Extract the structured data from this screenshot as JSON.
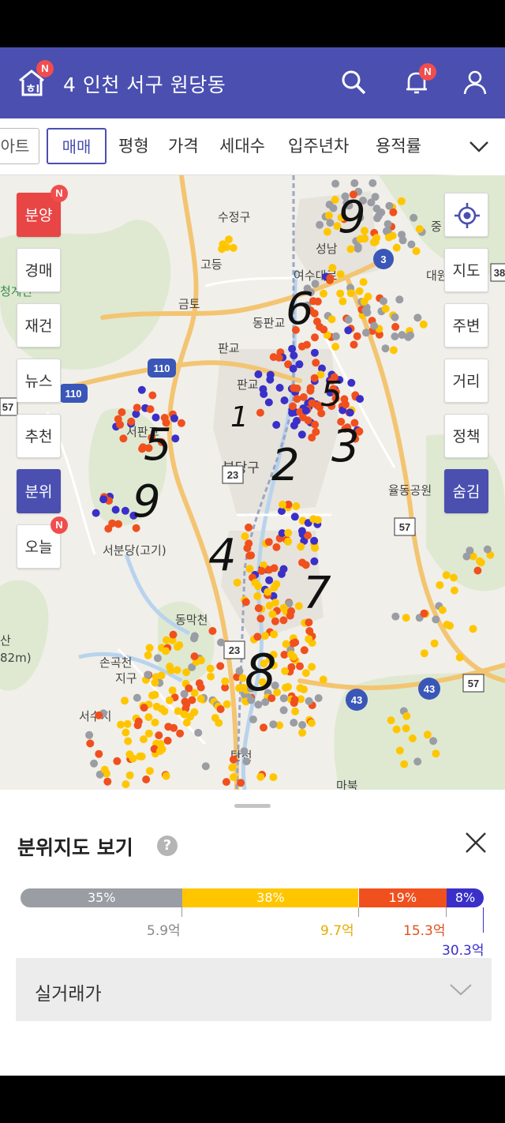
{
  "header": {
    "badge": "N",
    "region_title": "4 인천 서구 원당동",
    "notification_badge": "N"
  },
  "filter_bar": {
    "partial_chip": "아트",
    "active_chip": "매매",
    "tabs": [
      "평형",
      "가격",
      "세대수",
      "입주년차",
      "용적률"
    ]
  },
  "map": {
    "place_labels": [
      "수정구",
      "성남",
      "여수대로",
      "고등",
      "금토",
      "동판교",
      "판교",
      "판교",
      "서판교",
      "분당구",
      "율동공원",
      "서분당(고기)",
      "동막천",
      "손곡천",
      "지구",
      "서수지",
      "탄천",
      "마북",
      "중",
      "대원",
      "청계산",
      "산",
      "82m)"
    ],
    "road_numbers": [
      "110",
      "110",
      "57",
      "23",
      "23",
      "57",
      "43",
      "43",
      "3",
      "38",
      "57"
    ],
    "handwritten_numbers": [
      "9",
      "6",
      "5",
      "1",
      "5",
      "3",
      "2",
      "9",
      "4",
      "7",
      "8"
    ],
    "left_buttons": [
      {
        "label": "분양",
        "badge": "N"
      },
      {
        "label": "경매"
      },
      {
        "label": "재건"
      },
      {
        "label": "뉴스"
      },
      {
        "label": "추천"
      },
      {
        "label": "분위"
      },
      {
        "label": "오늘",
        "badge": "N"
      }
    ],
    "right_buttons": [
      "지도",
      "주변",
      "거리",
      "정책",
      "숨김"
    ]
  },
  "sheet": {
    "title": "분위지도 보기",
    "help": "?",
    "bar": [
      {
        "percent": "35%",
        "value": 35,
        "color": "#9a9da3"
      },
      {
        "percent": "38%",
        "value": 38,
        "color": "#ffc600"
      },
      {
        "percent": "19%",
        "value": 19,
        "color": "#f0501e"
      },
      {
        "percent": "8%",
        "value": 8,
        "color": "#3a2fc8"
      }
    ],
    "thresholds": [
      {
        "label": "5.9억",
        "color": "#888888"
      },
      {
        "label": "9.7억",
        "color": "#e6ac00"
      },
      {
        "label": "15.3억",
        "color": "#e0501e"
      },
      {
        "label": "30.3억",
        "color": "#3a2fc8"
      }
    ],
    "dropdown_label": "실거래가"
  }
}
